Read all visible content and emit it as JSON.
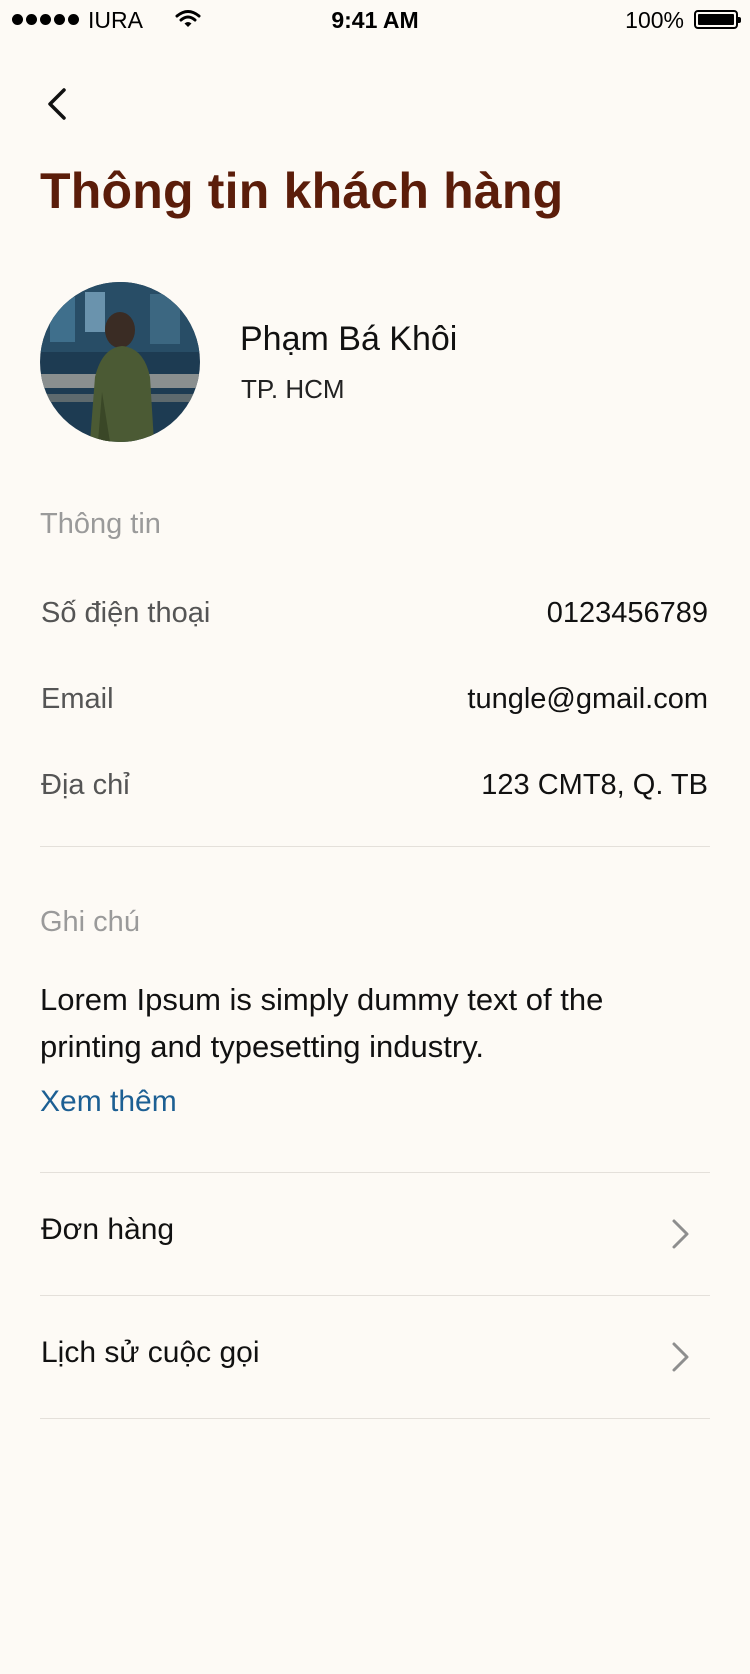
{
  "status_bar": {
    "carrier": "IURA",
    "time": "9:41 AM",
    "battery": "100%"
  },
  "header": {
    "title": "Thông tin khách hàng"
  },
  "profile": {
    "name": "Phạm Bá Khôi",
    "location": "TP. HCM"
  },
  "info": {
    "section_label": "Thông tin",
    "rows": [
      {
        "label": "Số điện thoại",
        "value": "0123456789"
      },
      {
        "label": "Email",
        "value": "tungle@gmail.com"
      },
      {
        "label": "Địa chỉ",
        "value": "123 CMT8, Q. TB"
      }
    ]
  },
  "note": {
    "section_label": "Ghi chú",
    "text": "Lorem Ipsum is simply dummy text of the printing and typesetting industry.",
    "more_label": "Xem thêm"
  },
  "nav": [
    {
      "label": "Đơn hàng"
    },
    {
      "label": "Lịch sử cuộc gọi"
    }
  ],
  "colors": {
    "title": "#5b1d0a",
    "link": "#1c5f93",
    "background": "#fdfaf5"
  }
}
